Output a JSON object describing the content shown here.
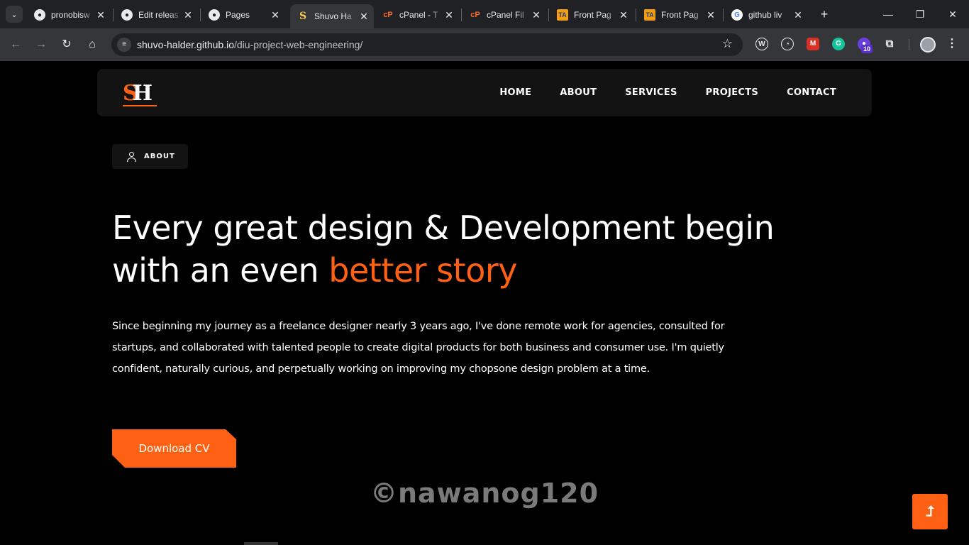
{
  "browser": {
    "tabs": [
      {
        "title": "pronobisw",
        "icon": "github-icon",
        "active": false
      },
      {
        "title": "Edit releas",
        "icon": "github-icon",
        "active": false
      },
      {
        "title": "Pages",
        "icon": "github-icon",
        "active": false
      },
      {
        "title": "Shuvo Ha",
        "icon": "site-s-icon",
        "active": true
      },
      {
        "title": "cPanel - T",
        "icon": "cpanel-icon",
        "active": false
      },
      {
        "title": "cPanel Fil",
        "icon": "cpanel-icon",
        "active": false
      },
      {
        "title": "Front Pag",
        "icon": "ta-icon",
        "active": false
      },
      {
        "title": "Front Pag",
        "icon": "ta-icon",
        "active": false
      },
      {
        "title": "github liv",
        "icon": "google-icon",
        "active": false
      }
    ],
    "url_host": "shuvo-halder.github.io",
    "url_path": "/diu-project-web-engineering/",
    "extension_badge": "10"
  },
  "site": {
    "logo_s": "S",
    "logo_h": "H",
    "nav": {
      "home": "HOME",
      "about": "ABOUT",
      "services": "SERVICES",
      "projects": "PROJECTS",
      "contact": "CONTACT"
    },
    "section_label": "ABOUT",
    "headline_main": "Every great design & Development begin with an even ",
    "headline_accent": "better story",
    "bio": "Since beginning my journey as a freelance designer nearly 3 years ago, I've done remote work for agencies, consulted for startups, and collaborated with talented people to create digital products for both business and consumer use. I'm quietly confident, naturally curious, and perpetually working on improving my chopsone design problem at a time.",
    "cv_button": "Download CV",
    "watermark": "©nawanog120",
    "accent_color": "#ff6114"
  }
}
